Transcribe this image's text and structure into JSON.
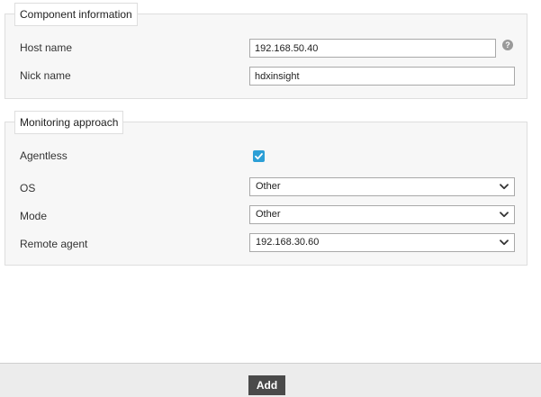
{
  "component_information": {
    "legend": "Component information",
    "host_name": {
      "label": "Host name",
      "value": "192.168.50.40",
      "help_icon": "question-circle-icon"
    },
    "nick_name": {
      "label": "Nick name",
      "value": "hdxinsight"
    }
  },
  "monitoring_approach": {
    "legend": "Monitoring approach",
    "agentless": {
      "label": "Agentless",
      "checked": true,
      "accent_color": "#2c9fd6"
    },
    "os": {
      "label": "OS",
      "selected": "Other"
    },
    "mode": {
      "label": "Mode",
      "selected": "Other"
    },
    "remote_agent": {
      "label": "Remote agent",
      "selected": "192.168.30.60"
    }
  },
  "footer": {
    "add_label": "Add",
    "button_color": "#4a4a4a"
  }
}
